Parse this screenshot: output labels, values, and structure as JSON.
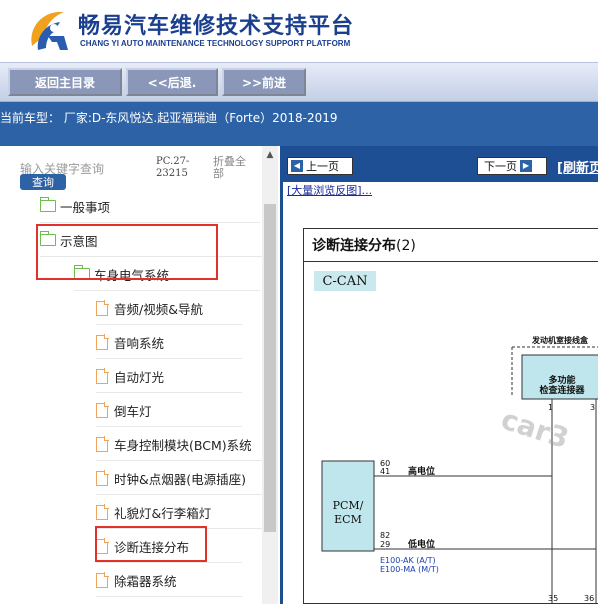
{
  "header": {
    "title_cn": "畅易汽车维修技术支持平台",
    "title_en": "CHANG YI AUTO MAINTENANCE TECHNOLOGY SUPPORT PLATFORM"
  },
  "nav": {
    "home": "返回主目录",
    "back": "<<后退.",
    "forward": ">>前进"
  },
  "vehicle": {
    "text": "当前车型： 厂家:D-东风悦达.起亚福瑞迪（Forte）2018-2019"
  },
  "sidebar": {
    "search_placeholder": "输入关键字查询",
    "search_button": "查询",
    "code_line1": "PC.27-",
    "code_line2": "23215",
    "collapse_line1": "折叠全",
    "collapse_line2": "部",
    "items": [
      {
        "label": "一般事项",
        "type": "folder"
      },
      {
        "label": "示意图",
        "type": "folder"
      },
      {
        "label": "车身电气系统",
        "type": "folder"
      },
      {
        "label": "音频/视频&导航",
        "type": "doc"
      },
      {
        "label": "音响系统",
        "type": "doc"
      },
      {
        "label": "自动灯光",
        "type": "doc"
      },
      {
        "label": "倒车灯",
        "type": "doc"
      },
      {
        "label": "车身控制模块(BCM)系统",
        "type": "doc"
      },
      {
        "label": "时钟&点烟器(电源插座)",
        "type": "doc"
      },
      {
        "label": "礼貌灯&行李箱灯",
        "type": "doc"
      },
      {
        "label": "诊断连接分布",
        "type": "doc"
      },
      {
        "label": "除霜器系统",
        "type": "doc"
      }
    ]
  },
  "content": {
    "prev": "上一页",
    "next": "下一页",
    "refresh": "[刷新页",
    "enlarge": "[大量浏览反图]...",
    "diagram": {
      "title": "诊断连接分布",
      "title_num": "(2)",
      "ccan": "C-CAN",
      "dlc_label": "发动机室接线盒",
      "multi_conn": "多功能",
      "multi_conn2": "检查连接器",
      "pcm_line1": "PCM/",
      "pcm_line2": "ECM",
      "high": "高电位",
      "low": "低电位",
      "pin60": "60",
      "pin41": "41",
      "pin82": "82",
      "pin29": "29",
      "pin1": "1",
      "pin3": "3",
      "pin35": "35",
      "pin36": "36",
      "conn_at": "E100-AK (A/T)",
      "conn_mt": "E100-MA (M/T)",
      "watermark": "car3"
    }
  },
  "colors": {
    "brand": "#1b3f8f",
    "bar": "#2d63a6",
    "highlight": "#e0312c",
    "module_fill": "#bfe6ec"
  }
}
